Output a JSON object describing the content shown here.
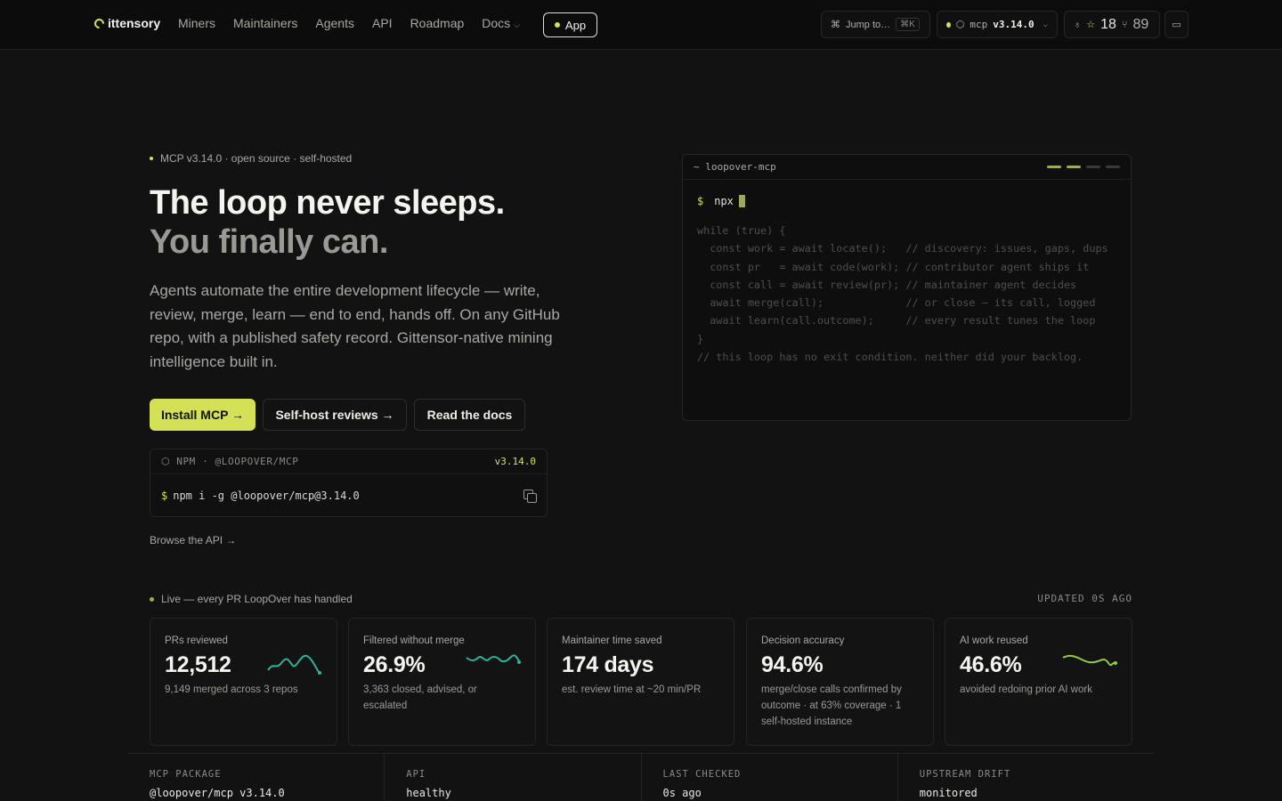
{
  "nav": {
    "logo": "ittensory",
    "links": [
      "Miners",
      "Maintainers",
      "Agents",
      "API",
      "Roadmap",
      "Docs"
    ],
    "app_label": "App",
    "jump_label": "Jump to…",
    "jump_kbd": "⌘K",
    "mcp_label": "mcp",
    "mcp_version": "v3.14.0",
    "stars": "18",
    "forks": "89"
  },
  "hero": {
    "eyebrow": "MCP v3.14.0 · open source · self-hosted",
    "title": "The loop never sleeps.",
    "title2": "You finally can.",
    "lede": "Agents automate the entire development lifecycle — write, review, merge, learn — end to end, hands off. On any GitHub repo, with a published safety record. Gittensor-native mining intelligence built in.",
    "btn_install": "Install MCP →",
    "btn_selfhost": "Self-host reviews →",
    "btn_docs": "Read the docs",
    "npm_label": "NPM · @LOOPOVER/MCP",
    "npm_version": "v3.14.0",
    "npm_cmd": "npm i -g @loopover/mcp@3.14.0",
    "browse": "Browse the API →"
  },
  "terminal": {
    "title": "~ loopover-mcp",
    "prompt": "npx",
    "code": "while (true) {\n  const work = await locate();   // discovery: issues, gaps, dups\n  const pr   = await code(work); // contributor agent ships it\n  const call = await review(pr); // maintainer agent decides\n  await merge(call);             // or close — its call, logged\n  await learn(call.outcome);     // every result tunes the loop\n}\n// this loop has no exit condition. neither did your backlog."
  },
  "live": {
    "label": "Live — every PR LoopOver has handled",
    "updated": "UPDATED 0S AGO",
    "cards": [
      {
        "label": "PRs reviewed",
        "value": "12,512",
        "sub": "9,149 merged across 3 repos",
        "spark_color": "#2bb39b"
      },
      {
        "label": "Filtered without merge",
        "value": "26.9%",
        "sub": "3,363 closed, advised, or escalated",
        "spark_color": "#2bb39b"
      },
      {
        "label": "Maintainer time saved",
        "value": "174 days",
        "sub": "est. review time at ~20 min/PR",
        "spark_color": ""
      },
      {
        "label": "Decision accuracy",
        "value": "94.6%",
        "sub": "merge/close calls confirmed by outcome · at 63% coverage · 1 self-hosted instance",
        "spark_color": ""
      },
      {
        "label": "AI work reused",
        "value": "46.6%",
        "sub": "avoided redoing prior AI work",
        "spark_color": "#8fce3f"
      }
    ]
  },
  "strip": [
    {
      "label": "MCP PACKAGE",
      "value": "@loopover/mcp v3.14.0"
    },
    {
      "label": "API",
      "value": "healthy"
    },
    {
      "label": "LAST CHECKED",
      "value": "0s ago"
    },
    {
      "label": "UPSTREAM DRIFT",
      "value": "monitored"
    }
  ],
  "colors": {
    "accent": "#d4e157",
    "teal": "#2bb39b",
    "green": "#8fce3f"
  }
}
